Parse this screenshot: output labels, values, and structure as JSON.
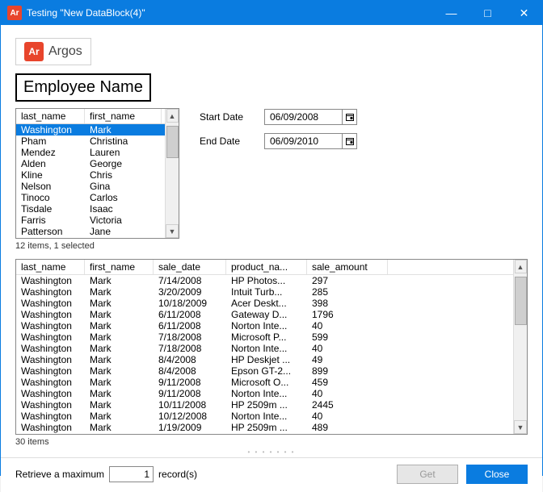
{
  "window": {
    "title": "Testing \"New DataBlock(4)\""
  },
  "logo": {
    "badge": "Ar",
    "name": "Argos"
  },
  "employee_panel": {
    "heading": "Employee Name",
    "columns": {
      "last": "last_name",
      "first": "first_name"
    },
    "rows": [
      {
        "last": "Washington",
        "first": "Mark",
        "selected": true
      },
      {
        "last": "Pham",
        "first": "Christina"
      },
      {
        "last": "Mendez",
        "first": "Lauren"
      },
      {
        "last": "Alden",
        "first": "George"
      },
      {
        "last": "Kline",
        "first": "Chris"
      },
      {
        "last": "Nelson",
        "first": "Gina"
      },
      {
        "last": "Tinoco",
        "first": "Carlos"
      },
      {
        "last": "Tisdale",
        "first": "Isaac"
      },
      {
        "last": "Farris",
        "first": "Victoria"
      },
      {
        "last": "Patterson",
        "first": "Jane"
      }
    ],
    "status": "12 items, 1 selected"
  },
  "dates": {
    "start": {
      "label": "Start Date",
      "value": "06/09/2008"
    },
    "end": {
      "label": "End Date",
      "value": "06/09/2010"
    }
  },
  "details": {
    "columns": {
      "last": "last_name",
      "first": "first_name",
      "sale_date": "sale_date",
      "product": "product_na...",
      "amount": "sale_amount"
    },
    "rows": [
      {
        "last": "Washington",
        "first": "Mark",
        "date": "7/14/2008",
        "product": "HP Photos...",
        "amount": "297"
      },
      {
        "last": "Washington",
        "first": "Mark",
        "date": "3/20/2009",
        "product": "Intuit Turb...",
        "amount": "285"
      },
      {
        "last": "Washington",
        "first": "Mark",
        "date": "10/18/2009",
        "product": "Acer Deskt...",
        "amount": "398"
      },
      {
        "last": "Washington",
        "first": "Mark",
        "date": "6/11/2008",
        "product": "Gateway D...",
        "amount": "1796"
      },
      {
        "last": "Washington",
        "first": "Mark",
        "date": "6/11/2008",
        "product": "Norton Inte...",
        "amount": "40"
      },
      {
        "last": "Washington",
        "first": "Mark",
        "date": "7/18/2008",
        "product": "Microsoft P...",
        "amount": "599"
      },
      {
        "last": "Washington",
        "first": "Mark",
        "date": "7/18/2008",
        "product": "Norton Inte...",
        "amount": "40"
      },
      {
        "last": "Washington",
        "first": "Mark",
        "date": "8/4/2008",
        "product": "HP Deskjet ...",
        "amount": "49"
      },
      {
        "last": "Washington",
        "first": "Mark",
        "date": "8/4/2008",
        "product": "Epson GT-2...",
        "amount": "899"
      },
      {
        "last": "Washington",
        "first": "Mark",
        "date": "9/11/2008",
        "product": "Microsoft O...",
        "amount": "459"
      },
      {
        "last": "Washington",
        "first": "Mark",
        "date": "9/11/2008",
        "product": "Norton Inte...",
        "amount": "40"
      },
      {
        "last": "Washington",
        "first": "Mark",
        "date": "10/11/2008",
        "product": "HP 2509m ...",
        "amount": "2445"
      },
      {
        "last": "Washington",
        "first": "Mark",
        "date": "10/12/2008",
        "product": "Norton Inte...",
        "amount": "40"
      },
      {
        "last": "Washington",
        "first": "Mark",
        "date": "1/19/2009",
        "product": "HP 2509m ...",
        "amount": "489"
      }
    ],
    "status": "30 items"
  },
  "footer": {
    "retrieve_prefix": "Retrieve a maximum",
    "retrieve_value": "1",
    "retrieve_suffix": "record(s)",
    "get_label": "Get",
    "close_label": "Close"
  }
}
